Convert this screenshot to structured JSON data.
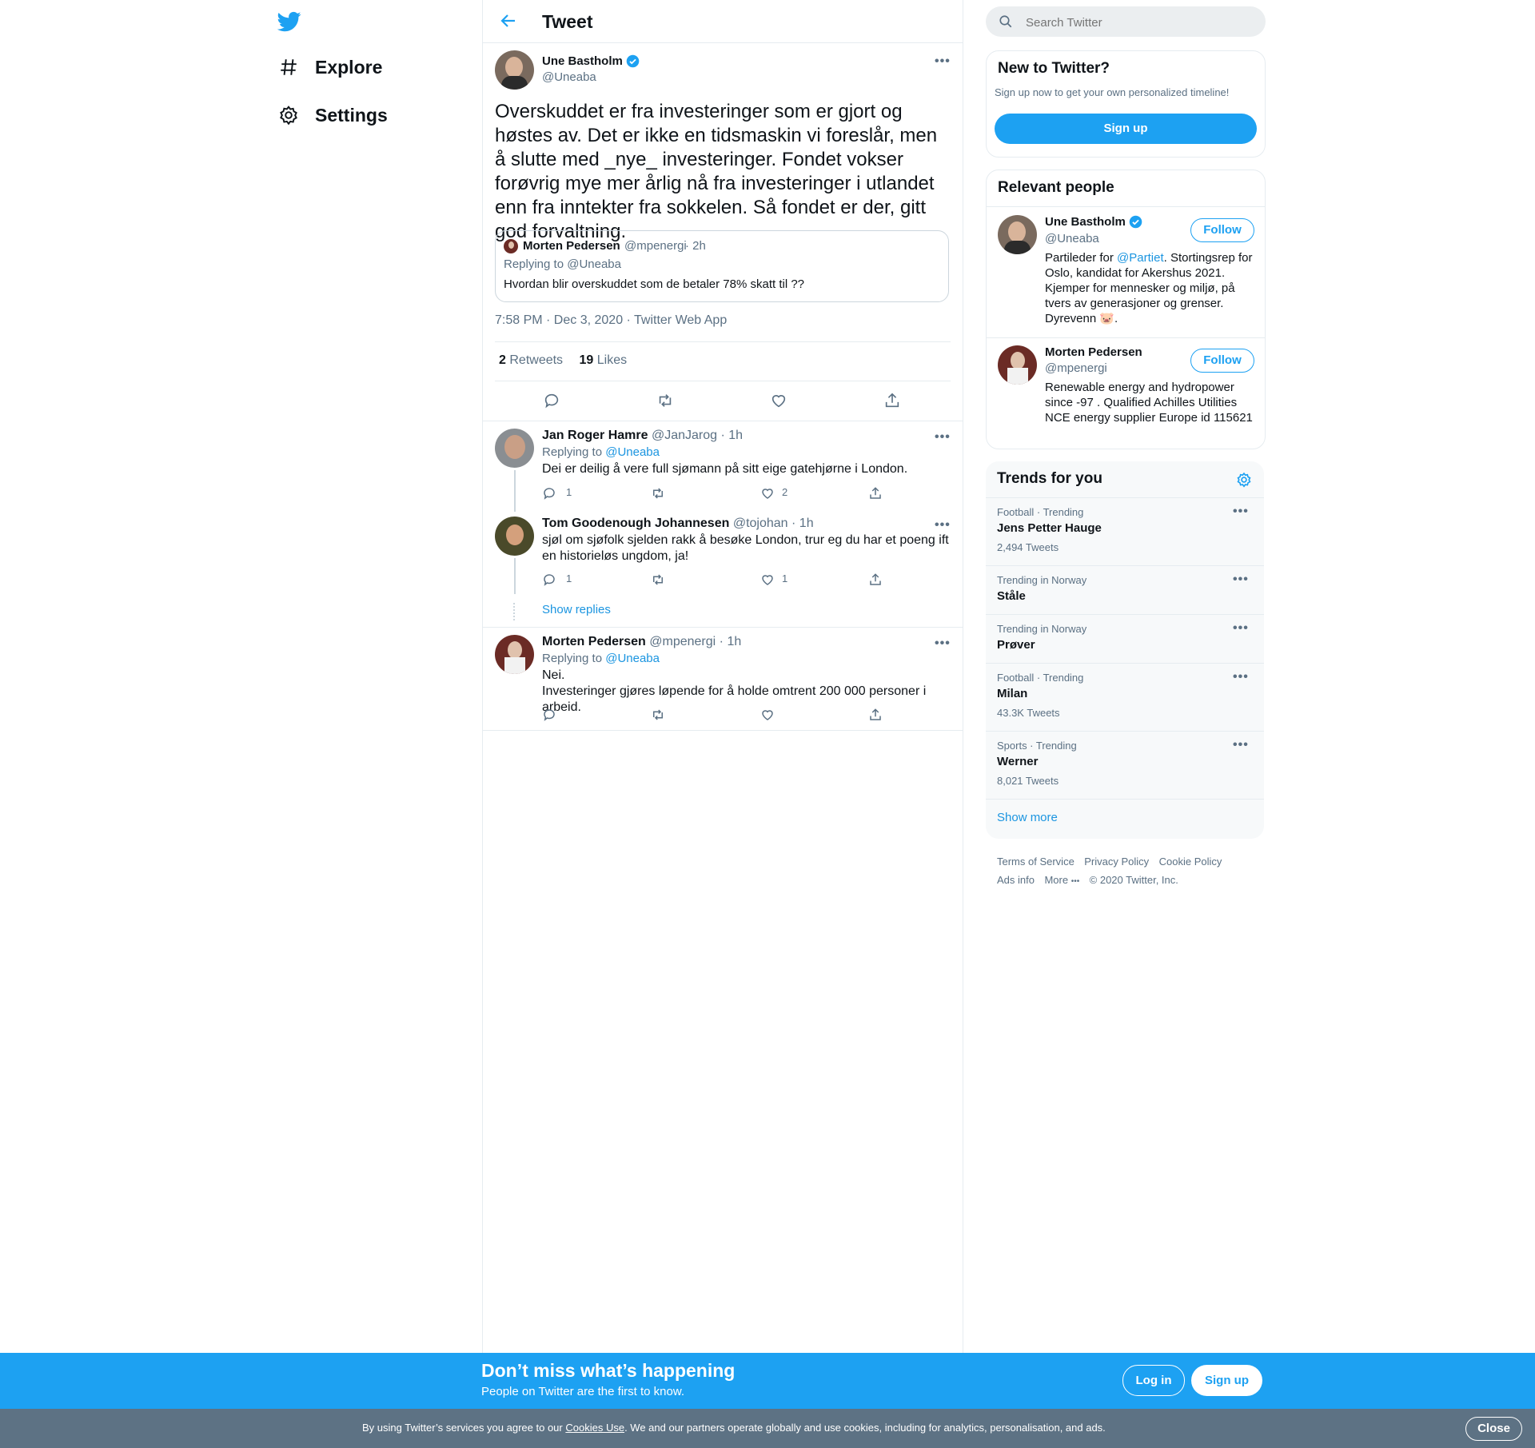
{
  "nav": {
    "explore_label": "Explore",
    "settings_label": "Settings"
  },
  "header": {
    "title": "Tweet"
  },
  "tweet": {
    "author_name": "Une Bastholm",
    "author_handle": "@Uneaba",
    "text": "Overskuddet er fra investeringer som er gjort og høstes av. Det er ikke en tidsmaskin vi foreslår, men å slutte med _nye_ investeringer. Fondet vokser forøvrig mye mer årlig nå fra investeringer i utlandet enn fra inntekter fra sokkelen. Så fondet er der, gitt god forvaltning.",
    "quote": {
      "author_name": "Morten Pedersen",
      "author_handle": "@mpenergi",
      "time": "· 2h",
      "replying_to": "Replying to @Uneaba",
      "text": "Hvordan blir overskuddet som de betaler 78% skatt til ??"
    },
    "meta": "7:58 PM · Dec 3, 2020 · Twitter Web App",
    "retweets_count": "2",
    "retweets_label": "Retweets",
    "likes_count": "19",
    "likes_label": "Likes"
  },
  "replies": [
    {
      "author_name": "Jan Roger Hamre",
      "author_handle": "@JanJarog",
      "time": "· 1h",
      "replying_prefix": "Replying to",
      "replying_handle": "@Uneaba",
      "text": "Dei er deilig å vere full sjømann på sitt eige gatehjørne i London.",
      "reply_count": "1",
      "like_count": "2"
    },
    {
      "author_name": "Tom Goodenough Johannesen",
      "author_handle": "@tojohan",
      "time": "· 1h",
      "text": "sjøl om sjøfolk sjelden rakk å besøke London, trur eg du har et poeng ift en historieløs ungdom, ja!",
      "reply_count": "1",
      "like_count": "1"
    },
    {
      "author_name": "Morten Pedersen",
      "author_handle": "@mpenergi",
      "time": "· 1h",
      "replying_prefix": "Replying to",
      "replying_handle": "@Uneaba",
      "text_line1": "Nei.",
      "text_line2": "Investeringer gjøres løpende for å holde omtrent 200 000 personer i arbeid."
    }
  ],
  "show_replies_label": "Show replies",
  "search": {
    "placeholder": "Search Twitter"
  },
  "new_to_twitter": {
    "title": "New to Twitter?",
    "subtitle": "Sign up now to get your own personalized timeline!",
    "button": "Sign up"
  },
  "relevant_people": {
    "title": "Relevant people",
    "people": [
      {
        "name": "Une Bastholm",
        "handle": "@Uneaba",
        "follow": "Follow",
        "bio_prefix": "Partileder for ",
        "bio_link": "@Partiet",
        "bio_rest": ". Stortingsrep for Oslo, kandidat for Akershus 2021. Kjemper for mennesker og miljø, på tvers av generasjoner og grenser. Dyrevenn 🐷."
      },
      {
        "name": "Morten Pedersen",
        "handle": "@mpenergi",
        "follow": "Follow",
        "bio": "Renewable energy and hydropower since -97 . Qualified Achilles Utilities NCE energy supplier Europe id 115621"
      }
    ]
  },
  "trends": {
    "title": "Trends for you",
    "items": [
      {
        "context": "Football · Trending",
        "name": "Jens Petter Hauge",
        "count": "2,494 Tweets"
      },
      {
        "context": "Trending in Norway",
        "name": "Ståle",
        "count": ""
      },
      {
        "context": "Trending in Norway",
        "name": "Prøver",
        "count": ""
      },
      {
        "context": "Football · Trending",
        "name": "Milan",
        "count": "43.3K Tweets"
      },
      {
        "context": "Sports · Trending",
        "name": "Werner",
        "count": "8,021 Tweets"
      }
    ],
    "show_more": "Show more"
  },
  "footer": {
    "terms": "Terms of Service",
    "privacy": "Privacy Policy",
    "cookie": "Cookie Policy",
    "ads": "Ads info",
    "more": "More",
    "copyright": "© 2020 Twitter, Inc."
  },
  "banner": {
    "title": "Don’t miss what’s happening",
    "subtitle": "People on Twitter are the first to know.",
    "login": "Log in",
    "signup": "Sign up"
  },
  "cookie_bar": {
    "text_before": "By using Twitter’s services you agree to our ",
    "link": "Cookies Use",
    "text_after": ". We and our partners operate globally and use cookies, including for analytics, personalisation, and ads.",
    "close": "Close"
  },
  "colors": {
    "brand": "#1da1f2",
    "link": "#1b95e0",
    "muted_text": "#5b7083",
    "border": "#e6ecf0",
    "cookie_bar": "#5d7284"
  }
}
